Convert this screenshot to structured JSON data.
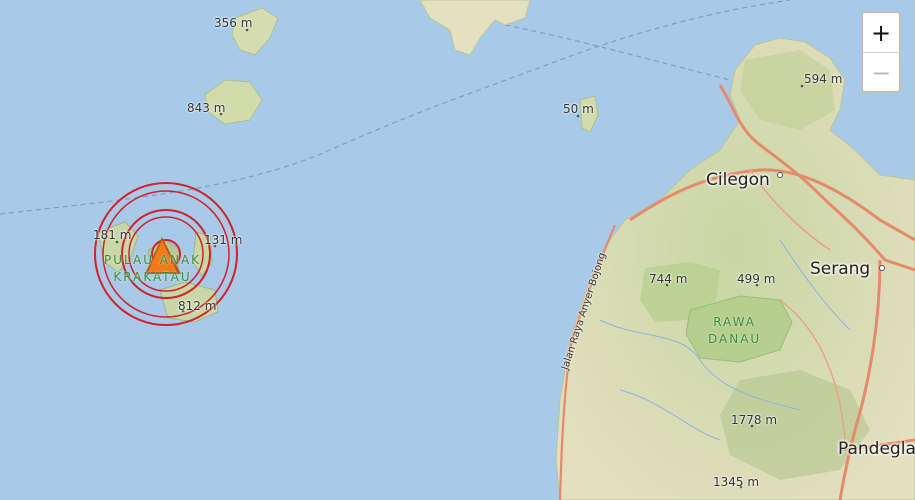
{
  "map": {
    "elevations": {
      "e356": "356 m",
      "e843": "843 m",
      "e50": "50 m",
      "e594": "594 m",
      "e181": "181 m",
      "e131": "131 m",
      "e812": "812 m",
      "e744": "744 m",
      "e499": "499 m",
      "e1778": "1778 m",
      "e1345": "1345 m"
    },
    "places": {
      "cilegon": "Cilegon",
      "serang": "Serang",
      "pandeglang": "Pandeglang"
    },
    "parks": {
      "krakatau_line1": "PULAU ANAK",
      "krakatau_line2": "KRAKATAU",
      "rawa_line1": "RAWA",
      "rawa_line2": "DANAU"
    },
    "road": "Jalan Raya Anyer Bojong"
  },
  "controls": {
    "zoom_in": "+",
    "zoom_out": "−"
  },
  "colors": {
    "water": "#a9c9e8",
    "land": "#e9e4c6",
    "forest": "#c9dcab",
    "road_major": "#e58a6c",
    "hazard_ring": "#d3202a",
    "volcano_marker": "#f07a1c"
  },
  "icons": {
    "volcano": "volcano-triangle-icon"
  }
}
